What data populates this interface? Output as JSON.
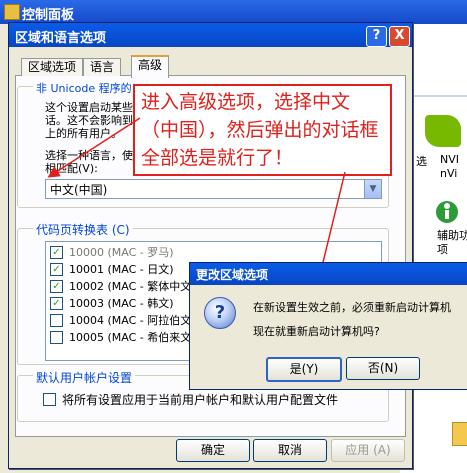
{
  "control_panel": {
    "title": "控制面板",
    "side_labels": {
      "select": "选",
      "nvidia": "NVI\nnVi",
      "assistant": "辅助功\n项"
    }
  },
  "region_dialog": {
    "title": "区域和语言选项",
    "help_glyph": "?",
    "close_glyph": "X",
    "tabs": [
      "区域选项",
      "语言",
      "高级"
    ],
    "active_tab": "高级",
    "non_unicode_group": {
      "title": "非 Unicode 程序的",
      "description": "这个设置启动某些\n话。这不会影响到\n上的所有用户。",
      "select_label": "选择一种语言，使\n相匹配(V):",
      "selected_language": "中文(中国)"
    },
    "code_page_group": {
      "title": "代码页转换表 (C)",
      "rows": [
        {
          "checked": true,
          "text": "10000  (MAC - 罗马)",
          "dim": true
        },
        {
          "checked": true,
          "text": "10001  (MAC - 日文)",
          "dim": false
        },
        {
          "checked": true,
          "text": "10002  (MAC - 繁体中文",
          "dim": false
        },
        {
          "checked": true,
          "text": "10003  (MAC - 韩文)",
          "dim": false
        },
        {
          "checked": false,
          "text": "10004  (MAC - 阿拉伯文",
          "dim": false
        },
        {
          "checked": false,
          "text": "10005  (MAC - 希伯来文",
          "dim": false
        }
      ]
    },
    "default_account_group": {
      "title": "默认用户帐户设置",
      "checkbox_label": "将所有设置应用于当前用户帐户和默认用户配置文件"
    },
    "buttons": {
      "ok": "确定",
      "cancel": "取消",
      "apply": "应用 (A)"
    }
  },
  "annotation": {
    "text": "进入高级选项，选择中文（中国），然后弹出的对话框全部选是就行了！",
    "color": "#e0201c"
  },
  "change_dialog": {
    "title": "更改区域选项",
    "message_line1": "在新设置生效之前，必须重新启动计算机",
    "message_line2": "现在就重新启动计算机吗?",
    "yes": "是(Y)",
    "no": "否(N)",
    "icon": "question-icon"
  }
}
